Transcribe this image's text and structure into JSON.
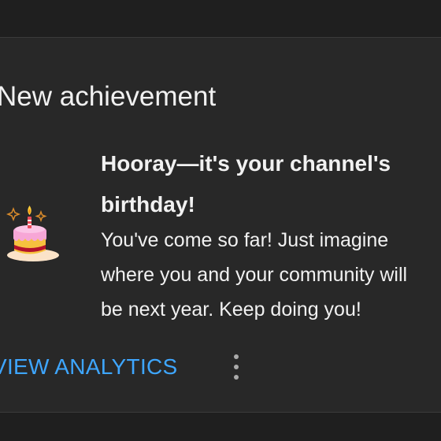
{
  "card": {
    "title": "New achievement",
    "headline": "Hooray—it's your channel's birthday!",
    "body": "You've come so far! Just imagine\nwhere you and your community will\nbe next year. Keep doing you!",
    "action_label": "VIEW ANALYTICS",
    "icon": "birthday-cake-icon",
    "more_icon": "more-vert-icon"
  },
  "colors": {
    "background": "#1f1f1f",
    "card": "#282828",
    "text": "#f1f1f1",
    "accent": "#3ea6ff",
    "cake_frosting": "#f7a6d6",
    "cake_base": "#f6c23e",
    "cake_band": "#b3122b"
  }
}
